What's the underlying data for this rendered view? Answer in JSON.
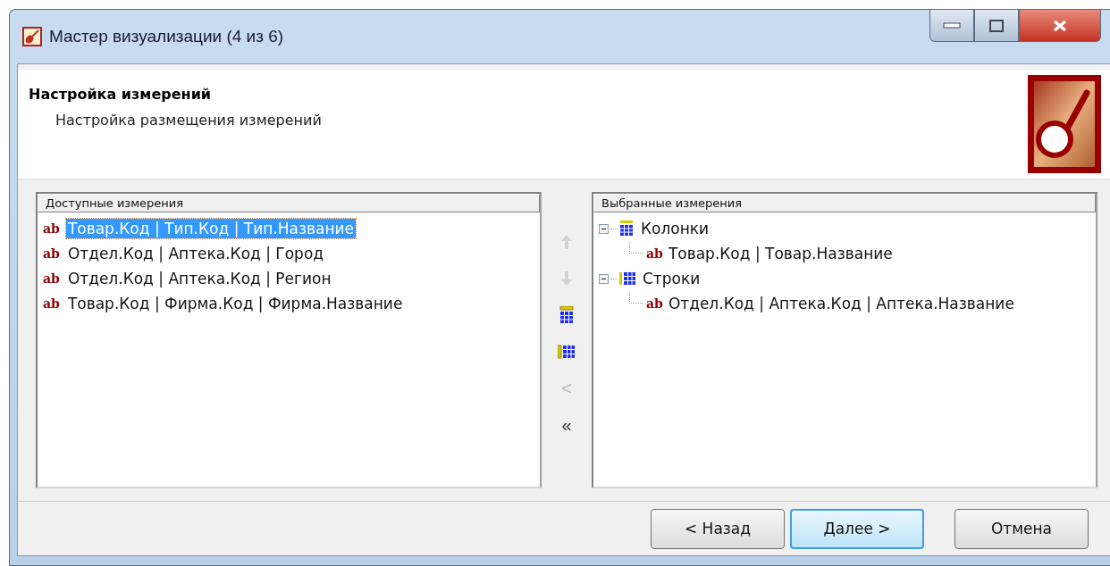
{
  "window": {
    "title": "Мастер визуализации (4 из 6)"
  },
  "header": {
    "title": "Настройка измерений",
    "subtitle": "Настройка размещения измерений"
  },
  "available": {
    "heading": "Доступные измерения",
    "items": [
      {
        "type_mark": "ab",
        "label": "Товар.Код | Тип.Код | Тип.Название",
        "selected": true
      },
      {
        "type_mark": "ab",
        "label": "Отдел.Код | Аптека.Код | Город",
        "selected": false
      },
      {
        "type_mark": "ab",
        "label": "Отдел.Код | Аптека.Код | Регион",
        "selected": false
      },
      {
        "type_mark": "ab",
        "label": "Товар.Код | Фирма.Код | Фирма.Название",
        "selected": false
      }
    ]
  },
  "move_buttons": [
    {
      "kind": "up",
      "disabled": true
    },
    {
      "kind": "down",
      "disabled": true
    },
    {
      "kind": "to_columns",
      "disabled": false
    },
    {
      "kind": "to_rows",
      "disabled": false
    },
    {
      "kind": "text",
      "label": "<",
      "disabled": true
    },
    {
      "kind": "text",
      "label": "«",
      "disabled": false
    }
  ],
  "selected": {
    "heading": "Выбранные измерения",
    "groups": [
      {
        "label": "Колонки",
        "kind": "columns",
        "expanded": true,
        "children": [
          {
            "type_mark": "ab",
            "label": "Товар.Код | Товар.Название"
          }
        ]
      },
      {
        "label": "Строки",
        "kind": "rows",
        "expanded": true,
        "children": [
          {
            "type_mark": "ab",
            "label": "Отдел.Код | Аптека.Код | Аптека.Название"
          }
        ]
      }
    ]
  },
  "buttons": [
    {
      "label": "< Назад",
      "default": false
    },
    {
      "label": "Далее >",
      "default": true
    },
    {
      "label": "Отмена",
      "default": false
    }
  ]
}
